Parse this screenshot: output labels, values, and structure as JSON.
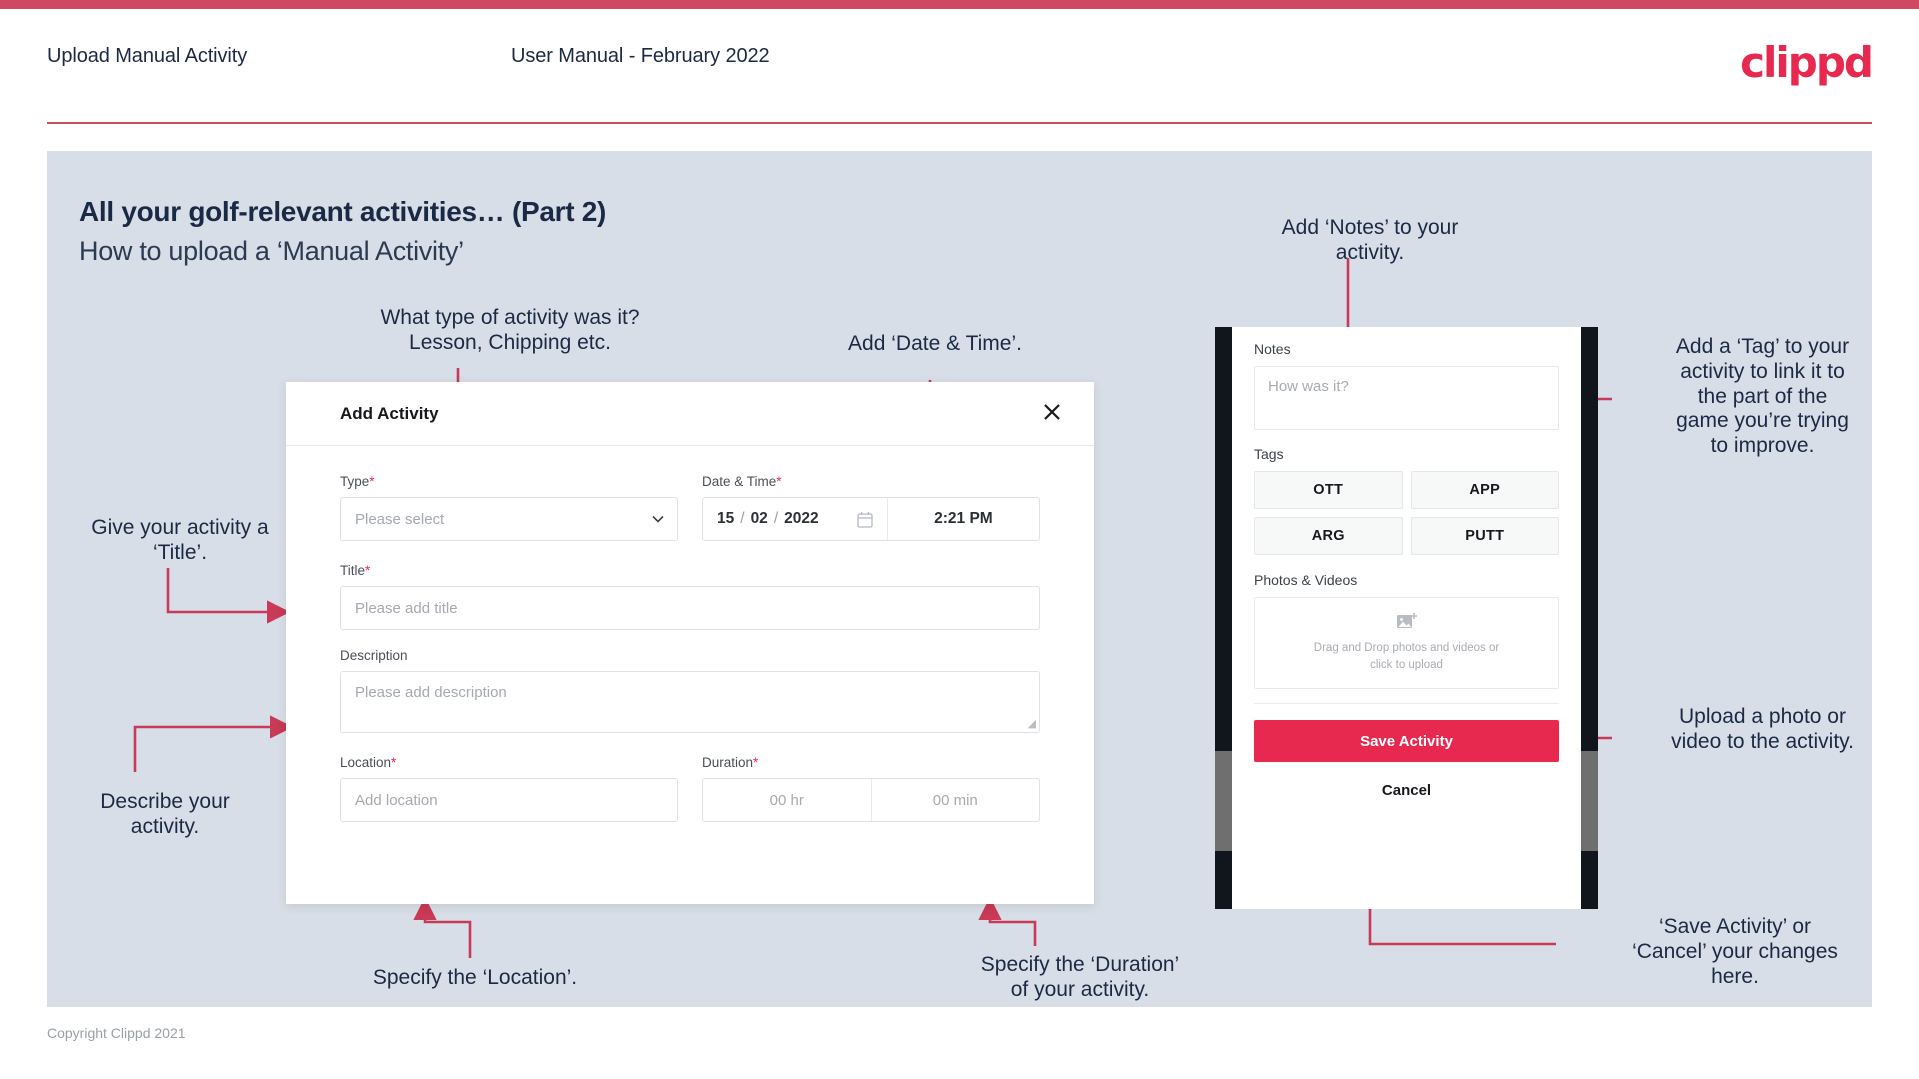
{
  "header": {
    "title": "Upload Manual Activity",
    "subtitle": "User Manual - February 2022",
    "logo": "clippd"
  },
  "slide": {
    "heading": "All your golf-relevant activities… (Part 2)",
    "subheading": "How to upload a ‘Manual Activity’"
  },
  "annotations": {
    "type": "What type of activity was it?\nLesson, Chipping etc.",
    "datetime": "Add ‘Date & Time’.",
    "title": "Give your activity a\n‘Title’.",
    "describe": "Describe your\nactivity.",
    "location": "Specify the ‘Location’.",
    "duration": "Specify the ‘Duration’\nof your activity.",
    "notes": "Add ‘Notes’ to your\nactivity.",
    "tag": "Add a ‘Tag’ to your\nactivity to link it to\nthe part of the\ngame you’re trying\nto improve.",
    "upload": "Upload a photo or\nvideo to the activity.",
    "save": "‘Save Activity’ or\n‘Cancel’ your changes\nhere."
  },
  "modal": {
    "title": "Add Activity",
    "close_icon": "close-icon",
    "fields": {
      "type": {
        "label": "Type",
        "required": "*",
        "placeholder": "Please select"
      },
      "datetime": {
        "label": "Date & Time",
        "required": "*",
        "day": "15",
        "sep1": "/",
        "month": "02",
        "sep2": "/",
        "year": "2022",
        "time": "2:21 PM"
      },
      "title": {
        "label": "Title",
        "required": "*",
        "placeholder": "Please add title"
      },
      "description": {
        "label": "Description",
        "placeholder": "Please add description"
      },
      "location": {
        "label": "Location",
        "required": "*",
        "placeholder": "Add location"
      },
      "duration": {
        "label": "Duration",
        "required": "*",
        "hours": "00 hr",
        "minutes": "00 min"
      }
    }
  },
  "phone": {
    "notes_label": "Notes",
    "notes_placeholder": "How was it?",
    "tags_label": "Tags",
    "tags": [
      "OTT",
      "APP",
      "ARG",
      "PUTT"
    ],
    "photos_label": "Photos & Videos",
    "dropzone_text": "Drag and Drop photos and videos or\nclick to upload",
    "save_label": "Save Activity",
    "cancel_label": "Cancel"
  },
  "footer": {
    "copyright": "Copyright Clippd 2021"
  },
  "colors": {
    "accent": "#e8294f",
    "accent_dark": "#cf4961",
    "slide_bg": "#d8dee7",
    "ink": "#1b2a44"
  }
}
